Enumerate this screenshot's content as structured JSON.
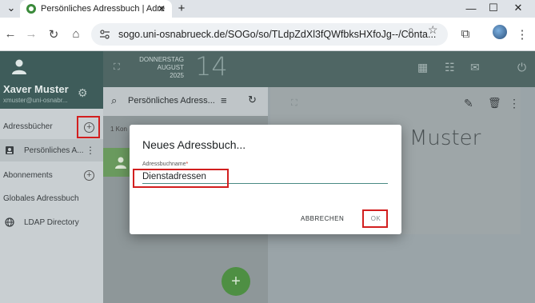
{
  "browser": {
    "tab_title": "Persönliches Adressbuch | Adre",
    "url": "sogo.uni-osnabrueck.de/SOGo/so/TLdpZdXl3fQWfbksHXfoJg--/Conta..."
  },
  "user": {
    "name": "Xaver Muster",
    "email": "xmuster@uni-osnabr..."
  },
  "header": {
    "weekday": "DONNERSTAG",
    "month": "AUGUST",
    "year": "2025",
    "day": "14"
  },
  "sidebar": {
    "addressbooks_label": "Adressbücher",
    "personal_book": "Persönliches A...",
    "subscriptions_label": "Abonnements",
    "global_label": "Globales Adressbuch",
    "ldap_label": "LDAP Directory"
  },
  "list": {
    "title": "Persönliches Adress...",
    "count": "1 Kon"
  },
  "detail": {
    "name_fragment": "Muster"
  },
  "dialog": {
    "title": "Neues Adressbuch...",
    "field_label": "Adressbuchname",
    "field_required_mark": "*",
    "field_value": "Dienstadressen",
    "cancel_label": "ABBRECHEN",
    "ok_label": "OK"
  },
  "colors": {
    "highlight": "#d21f1f",
    "sidebar_header": "#3e5c5a",
    "fab": "#4e8f43"
  }
}
